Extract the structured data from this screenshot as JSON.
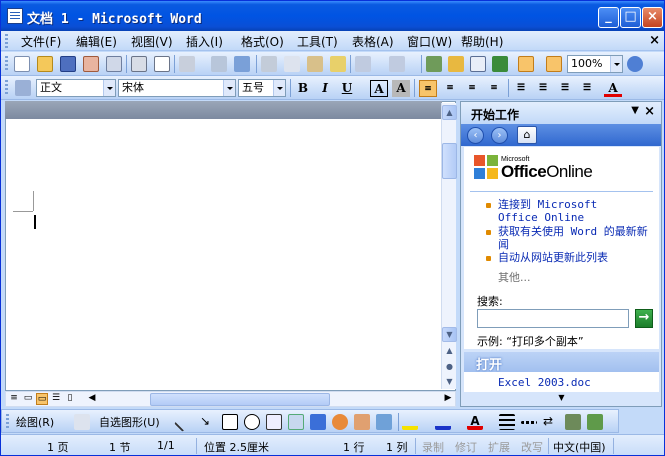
{
  "window": {
    "title": "文档 1 - Microsoft Word",
    "buttons": {
      "minimize": "_",
      "maximize": "□",
      "close": "×"
    }
  },
  "menu": {
    "items": [
      "文件(F)",
      "编辑(E)",
      "视图(V)",
      "插入(I)",
      "格式(O)",
      "工具(T)",
      "表格(A)",
      "窗口(W)",
      "帮助(H)"
    ],
    "close_doc": "×"
  },
  "standard_toolbar": {
    "zoom": "100%",
    "icons": [
      "new-icon",
      "open-icon",
      "save-icon",
      "permission-icon",
      "email-icon",
      "print-icon",
      "print-preview-icon",
      "traditional-chinese-icon",
      "research-icon",
      "cut-icon",
      "copy-icon",
      "paste-icon",
      "format-painter-icon",
      "undo-icon",
      "redo-icon",
      "hyperlink-icon",
      "tables-borders-icon",
      "insert-table-icon",
      "insert-excel-icon",
      "columns-icon",
      "drawing-icon",
      "document-map-icon",
      "show-hide-icon",
      "help-icon"
    ]
  },
  "formatting_toolbar": {
    "style": "正文",
    "font": "宋体",
    "size": "五号",
    "bold": "B",
    "italic": "I",
    "underline": "U",
    "char_border": "A",
    "char_shading": "A",
    "font_color": "A"
  },
  "task_pane": {
    "title": "开始工作",
    "logo_small": "Microsoft",
    "logo_brand": "Office",
    "logo_online": "Online",
    "links": [
      "连接到 Microsoft Office Online",
      "获取有关使用 Word 的最新新闻",
      "自动从网站更新此列表"
    ],
    "more": "其他...",
    "search_label": "搜索:",
    "search_value": "",
    "example": "示例: “打印多个副本”",
    "open_section": "打开",
    "recent_file": "Excel 2003.doc"
  },
  "drawing_toolbar": {
    "draw": "绘图(R)",
    "autoshapes": "自选图形(U)"
  },
  "status_bar": {
    "page": "1 页",
    "section": "1 节",
    "page_of": "1/1",
    "position": "位置 2.5厘米",
    "line": "1 行",
    "column": "1 列",
    "rec": "录制",
    "trk": "修订",
    "ext": "扩展",
    "ovr": "改写",
    "language": "中文(中国)"
  },
  "colors": {
    "title_bar": "#0054e3",
    "toolbar": "#c2d9f8",
    "task_pane_nav": "#3068cf",
    "link": "#0a2bb4"
  }
}
